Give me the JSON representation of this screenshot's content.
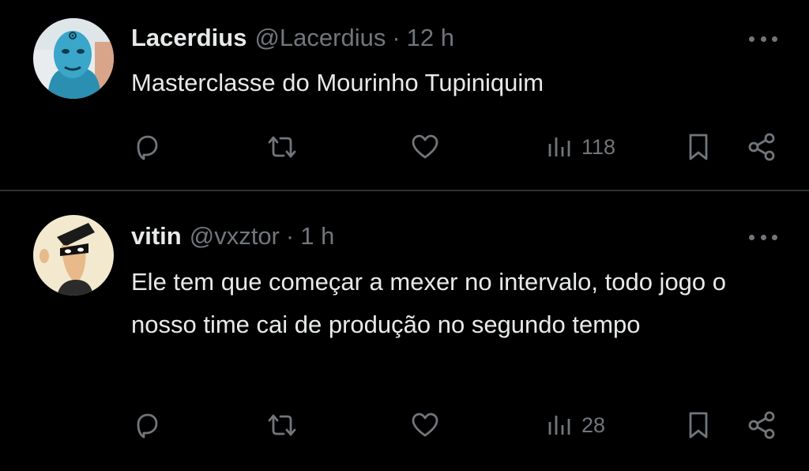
{
  "tweets": [
    {
      "name": "Lacerdius",
      "handle": "@Lacerdius",
      "separator": "·",
      "time": "12 h",
      "text": "Masterclasse do Mourinho Tupiniquim",
      "views": "118",
      "avatar_icon": "blue-face-avatar"
    },
    {
      "name": "vitin",
      "handle": "@vxztor",
      "separator": "·",
      "time": "1 h",
      "text": "Ele tem que começar a mexer no intervalo, todo jogo o nosso time cai de produção no segundo tempo",
      "views": "28",
      "avatar_icon": "cartoon-masked-character-avatar"
    }
  ],
  "icons": {
    "reply": "reply-icon",
    "retweet": "retweet-icon",
    "like": "heart-icon",
    "views": "views-icon",
    "bookmark": "bookmark-icon",
    "share": "share-icon",
    "more": "more-icon"
  },
  "colors": {
    "background": "#000000",
    "text": "#e7e9ea",
    "muted": "#71767b",
    "divider": "#2f3336"
  }
}
